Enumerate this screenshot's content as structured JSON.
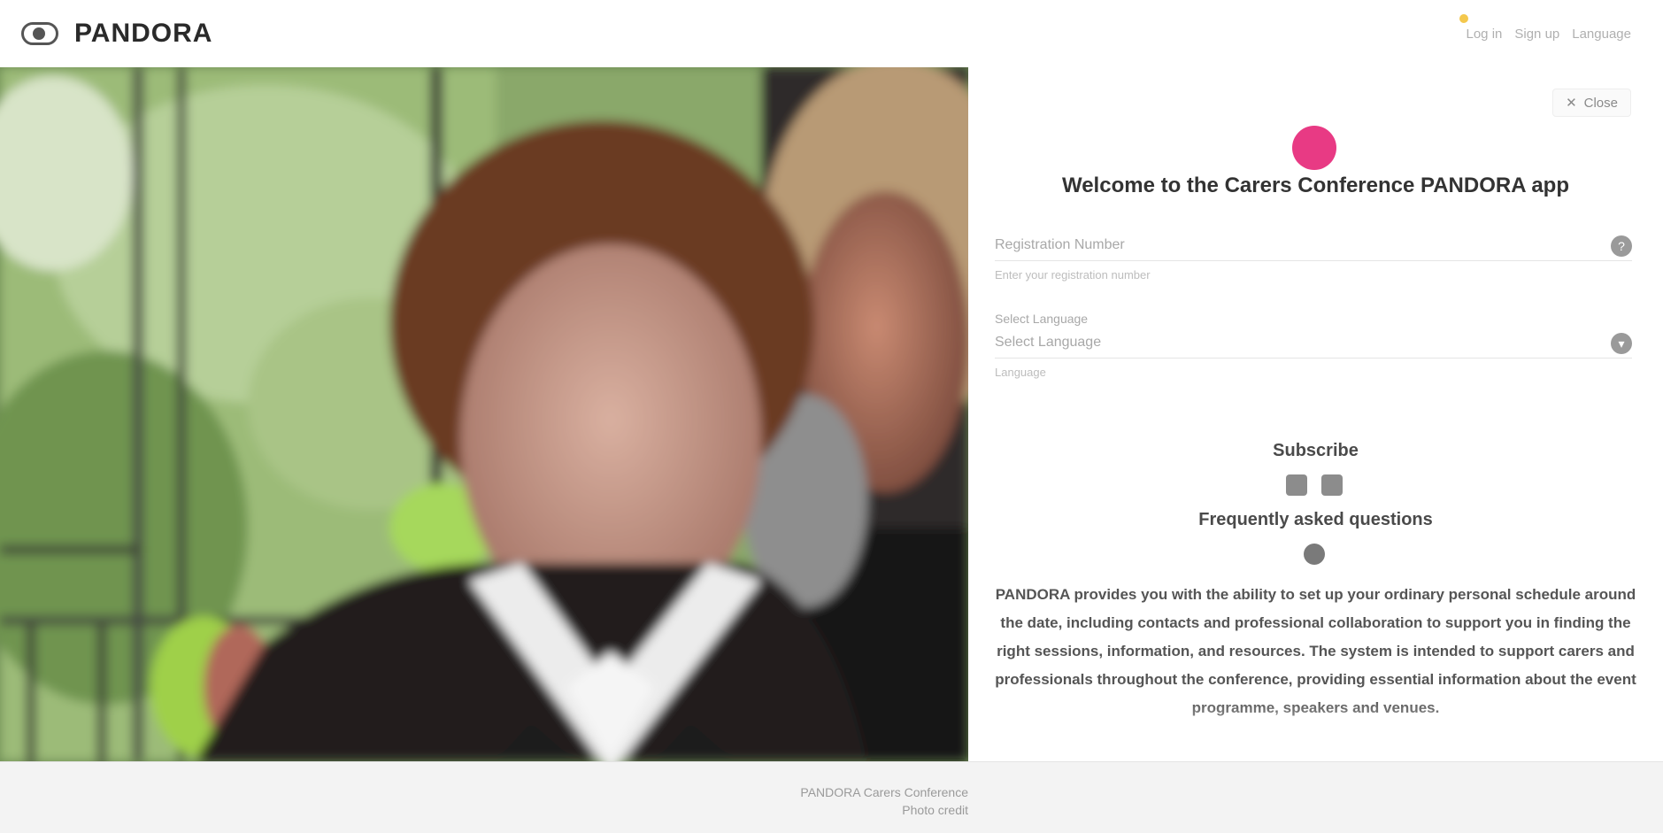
{
  "topbar": {
    "logo_text": "PANDORA",
    "links": [
      "Log in",
      "Sign up",
      "Language"
    ]
  },
  "hero": {
    "alt": "Elderly woman with a younger woman resting her head beside her"
  },
  "pane": {
    "close_label": "Close",
    "welcome": "Welcome to the Carers Conference PANDORA app",
    "fields": [
      {
        "label": "Registration Number",
        "value": "",
        "placeholder": "Registration Number",
        "hint": "Enter your registration number"
      },
      {
        "label": "Select Language",
        "value": "",
        "placeholder": "Select Language",
        "hint": "Language"
      }
    ],
    "subtitle": "Subscribe",
    "section_title": "Frequently asked questions",
    "body": "PANDORA provides you with the ability to set up your ordinary personal schedule around the date, including contacts and professional collaboration to support you in finding the right sessions, information, and resources. The system is intended to support carers and professionals throughout the conference, providing essential information about the event programme, speakers and venues."
  },
  "footer": {
    "credit_line1": "PANDORA Carers Conference",
    "credit_line2": "Photo credit"
  },
  "colors": {
    "brand_pink": "#e83a84",
    "accent_yellow": "#f4c84d"
  }
}
